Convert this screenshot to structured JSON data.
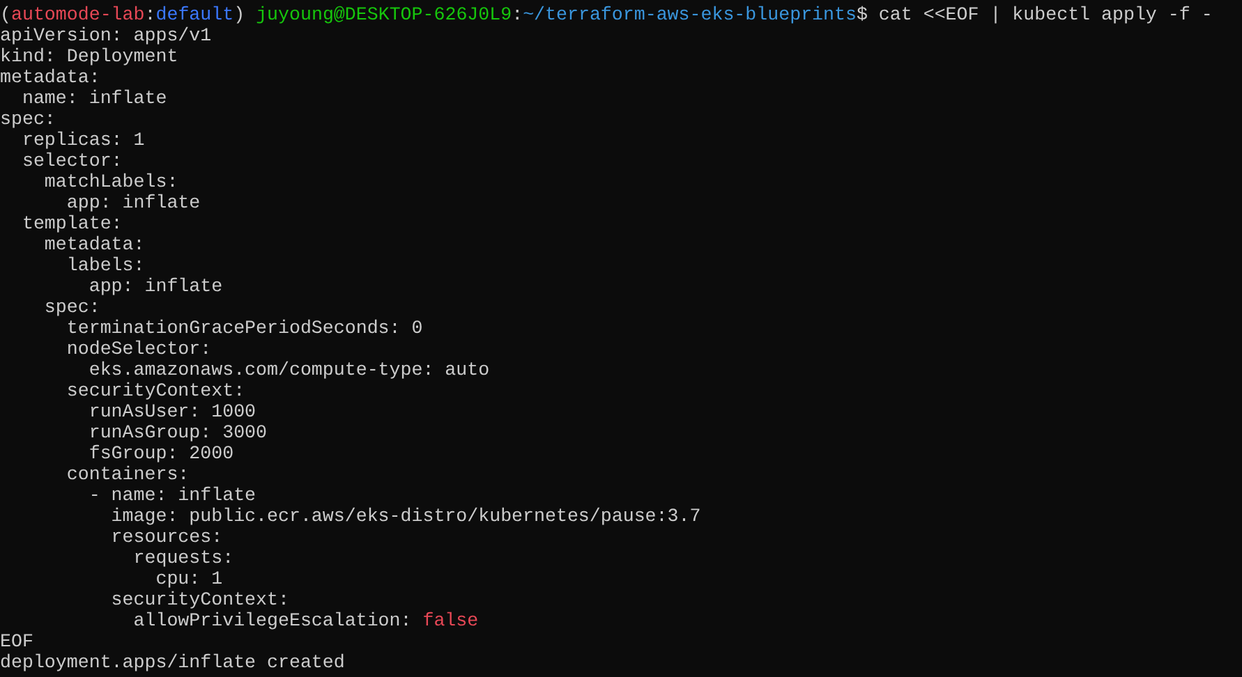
{
  "prompt": [
    {
      "kind": "plain",
      "text": "("
    },
    {
      "kind": "env",
      "text": "automode-lab"
    },
    {
      "kind": "plain",
      "text": ":"
    },
    {
      "kind": "context",
      "text": "default"
    },
    {
      "kind": "plain",
      "text": ") "
    },
    {
      "kind": "user",
      "text": "juyoung@DESKTOP-626J0L9"
    },
    {
      "kind": "plain",
      "text": ":"
    },
    {
      "kind": "path",
      "text": "~/terraform-aws-eks-blueprints"
    },
    {
      "kind": "plain",
      "text": "$ cat <<EOF | kubectl apply -f -"
    }
  ],
  "lines": [
    {
      "kind": "plain",
      "text": "apiVersion: apps/v1"
    },
    {
      "kind": "plain",
      "text": "kind: Deployment"
    },
    {
      "kind": "plain",
      "text": "metadata:"
    },
    {
      "kind": "plain",
      "text": "  name: inflate"
    },
    {
      "kind": "plain",
      "text": "spec:"
    },
    {
      "kind": "plain",
      "text": "  replicas: 1"
    },
    {
      "kind": "plain",
      "text": "  selector:"
    },
    {
      "kind": "plain",
      "text": "    matchLabels:"
    },
    {
      "kind": "plain",
      "text": "      app: inflate"
    },
    {
      "kind": "plain",
      "text": "  template:"
    },
    {
      "kind": "plain",
      "text": "    metadata:"
    },
    {
      "kind": "plain",
      "text": "      labels:"
    },
    {
      "kind": "plain",
      "text": "        app: inflate"
    },
    {
      "kind": "plain",
      "text": "    spec:"
    },
    {
      "kind": "plain",
      "text": "      terminationGracePeriodSeconds: 0"
    },
    {
      "kind": "plain",
      "text": "      nodeSelector:"
    },
    {
      "kind": "plain",
      "text": "        eks.amazonaws.com/compute-type: auto"
    },
    {
      "kind": "plain",
      "text": "      securityContext:"
    },
    {
      "kind": "plain",
      "text": "        runAsUser: 1000"
    },
    {
      "kind": "plain",
      "text": "        runAsGroup: 3000"
    },
    {
      "kind": "plain",
      "text": "        fsGroup: 2000"
    },
    {
      "kind": "plain",
      "text": "      containers:"
    },
    {
      "kind": "plain",
      "text": "        - name: inflate"
    },
    {
      "kind": "plain",
      "text": "          image: public.ecr.aws/eks-distro/kubernetes/pause:3.7"
    },
    {
      "kind": "plain",
      "text": "          resources:"
    },
    {
      "kind": "plain",
      "text": "            requests:"
    },
    {
      "kind": "plain",
      "text": "              cpu: 1"
    },
    {
      "kind": "plain",
      "text": "          securityContext:"
    },
    {
      "kind": "bool",
      "text": "            allowPrivilegeEscalation: ",
      "value": "false"
    },
    {
      "kind": "plain",
      "text": "EOF"
    },
    {
      "kind": "plain",
      "text": "deployment.apps/inflate created"
    }
  ]
}
